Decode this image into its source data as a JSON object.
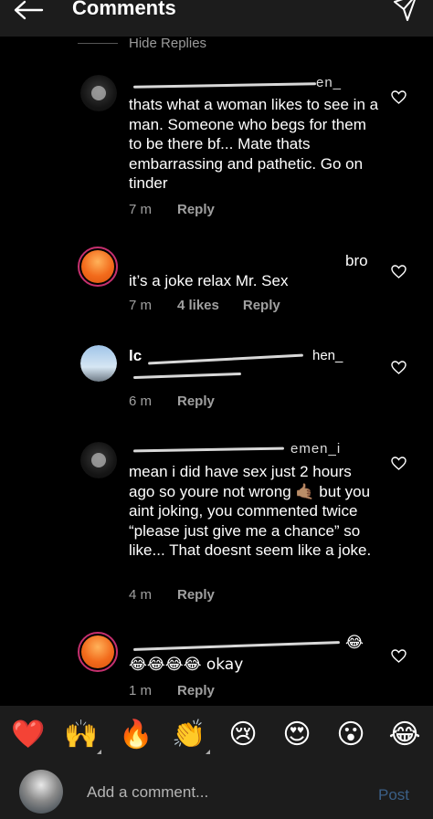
{
  "header": {
    "title": "Comments"
  },
  "thread": {
    "hide_replies_label": "Hide Replies"
  },
  "comments": [
    {
      "username": "____",
      "username_suffix": "en_",
      "text": "thats what a woman likes to see in a man. Someone who begs for them to be there bf... Mate thats embarrassing and pathetic. Go on tinder",
      "time": "7 m",
      "likes": "",
      "reply": "Reply"
    },
    {
      "username": "bro",
      "text": "it’s a joke relax Mr. Sex",
      "time": "7 m",
      "likes": "4 likes",
      "reply": "Reply"
    },
    {
      "username": "lc",
      "username_suffix": "hen_",
      "text": "",
      "time": "6 m",
      "likes": "",
      "reply": "Reply"
    },
    {
      "username": "i",
      "username_suffix": "emen_i",
      "text": "mean i did have sex just 2 hours ago so youre not wrong 🤙🏽 but you aint joking, you commented twice “please just give me a chance” so like... That doesnt seem like a joke.",
      "time": "4 m",
      "likes": "",
      "reply": "Reply"
    },
    {
      "username": "😂",
      "text": "😂😂😂😂 okay",
      "time": "1 m",
      "likes": "",
      "reply": "Reply"
    }
  ],
  "emoji_bar": [
    "❤️",
    "🙌",
    "🔥",
    "👏",
    "😢",
    "😍",
    "😮",
    "😂"
  ],
  "composer": {
    "placeholder": "Add a comment...",
    "post_label": "Post"
  },
  "colors": {
    "background": "#000000",
    "bar": "#1c1c1c",
    "link_disabled": "#3b5f86",
    "story_ring": "#c5306e"
  }
}
